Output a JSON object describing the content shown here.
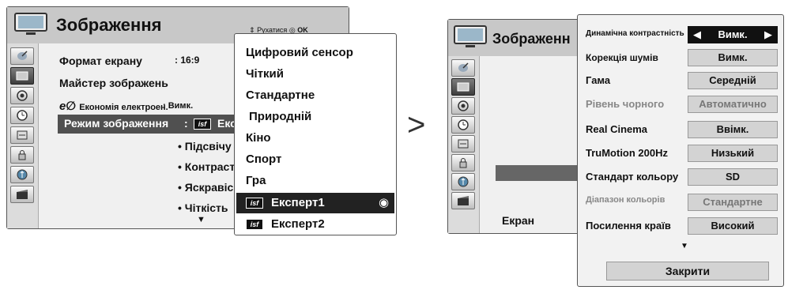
{
  "left_screen": {
    "title": "Зображення",
    "hint": "Рухатися",
    "hint_ok": "OK",
    "menu": [
      {
        "label": "Формат екрану",
        "value": ": 16:9"
      },
      {
        "label": "Майстер зображень",
        "value": ""
      },
      {
        "label": "Економія електроен.",
        "value": ": Вимк."
      },
      {
        "label": "Режим зображення",
        "value": ":",
        "value_text": "Екс"
      }
    ],
    "sub_items": [
      "• Підсвічу",
      "• Контраст",
      "• Яскравіс",
      "• Чіткість"
    ],
    "isf_badge": "isf",
    "popup": {
      "items": [
        "Цифровий сенсор",
        "Чіткий",
        "Стандартне",
        "Природній",
        "Кіно",
        "Спорт",
        "Гра",
        "Експерт1",
        "Експерт2"
      ],
      "selected": "Експерт1"
    }
  },
  "arrow": ">",
  "right_screen": {
    "title": "Зображенн",
    "bottom_label": "Екран",
    "settings": [
      {
        "label": "Динамічна контрастність",
        "value": "Вимк.",
        "enabled": true,
        "active": true
      },
      {
        "label": "Корекція шумів",
        "value": "Вимк.",
        "enabled": true
      },
      {
        "label": "Гама",
        "value": "Середній",
        "enabled": true
      },
      {
        "label": "Рівень чорного",
        "value": "Автоматично",
        "enabled": false
      },
      {
        "label": "Real Cinema",
        "value": "Ввімк.",
        "enabled": true
      },
      {
        "label": "TruMotion 200Hz",
        "value": "Низький",
        "enabled": true
      },
      {
        "label": "Стандарт кольору",
        "value": "SD",
        "enabled": true
      },
      {
        "label": "Діапазон кольорів",
        "value": "Стандартне",
        "enabled": false
      },
      {
        "label": "Посилення країв",
        "value": "Високий",
        "enabled": true
      }
    ],
    "close_label": "Закрити"
  },
  "icons": [
    "tv-icon",
    "satellite-dish-icon",
    "picture-icon",
    "audio-icon",
    "clock-icon",
    "lock-icon",
    "option-icon",
    "usb-icon",
    "movie-icon"
  ]
}
